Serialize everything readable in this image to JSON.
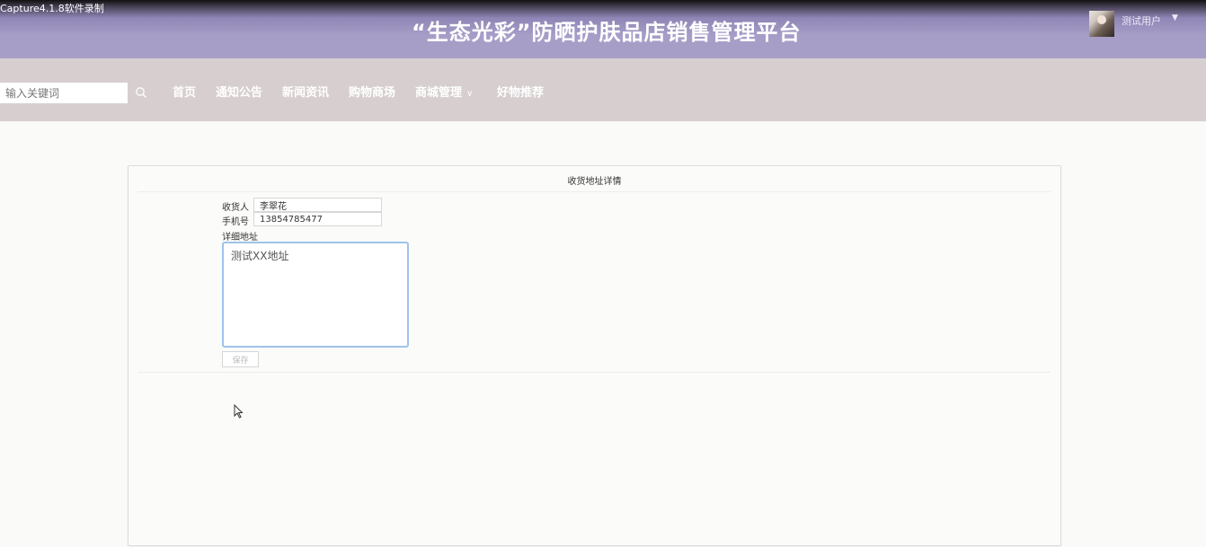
{
  "watermark": "Capture4.1.8软件录制",
  "header": {
    "title": "“生态光彩”防晒护肤品店销售管理平台",
    "user_name": "测试用户",
    "user_caret": "▼"
  },
  "nav": {
    "search_placeholder": "输入关键词",
    "items": [
      "首页",
      "通知公告",
      "新闻资讯",
      "购物商场",
      "商城管理",
      "好物推荐"
    ],
    "dropdown_chevron": "∨"
  },
  "card": {
    "title": "收货地址详情",
    "receiver_label": "收货人",
    "receiver_value": "李翠花",
    "phone_label": "手机号",
    "phone_value": "13854785477",
    "address_label": "详细地址",
    "address_value": "测试XX地址",
    "save_label": "保存"
  },
  "colors": {
    "header_bg": "#a79ec8",
    "nav_bg": "#d7cfcf",
    "focus_border": "#9fc2ea"
  }
}
